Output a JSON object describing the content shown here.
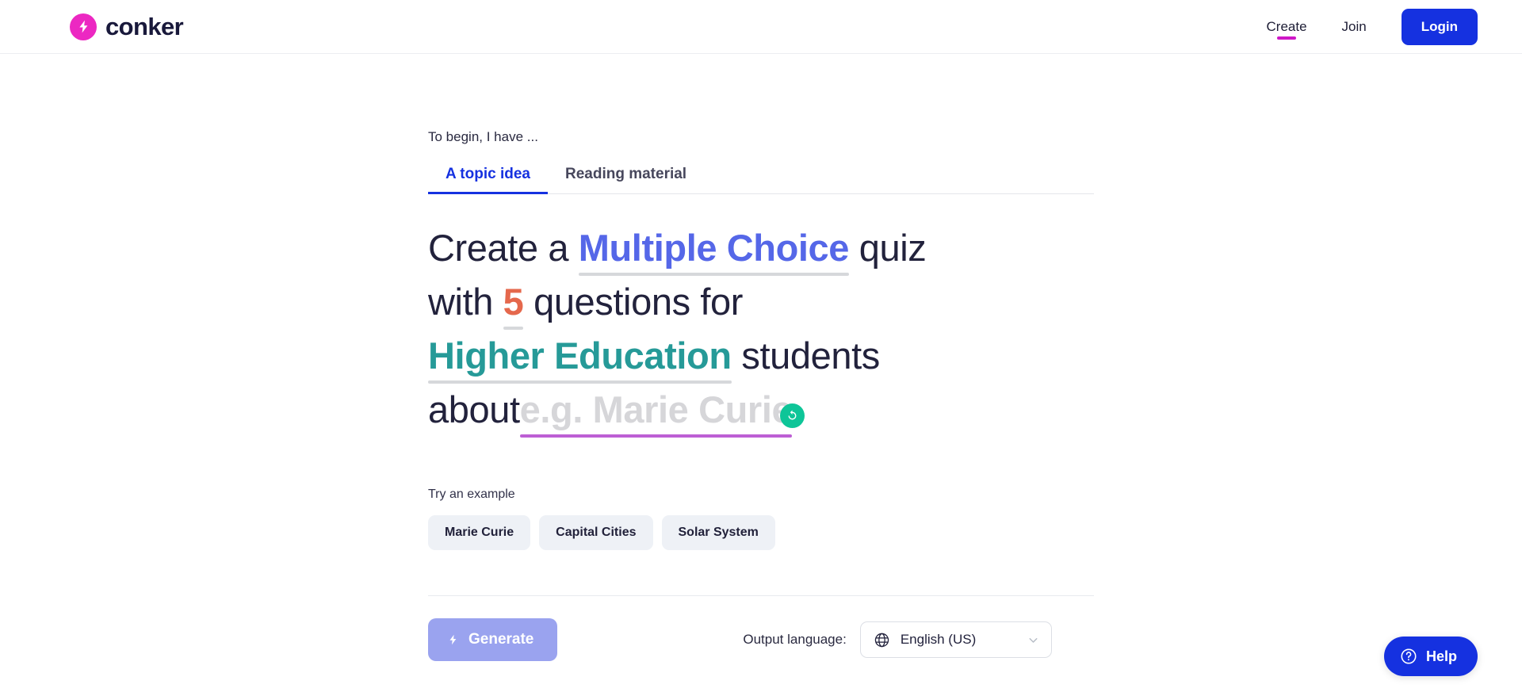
{
  "brand": {
    "name": "conker",
    "logo_icon": "lightning-bolt-icon",
    "logo_color": "#ec28c2"
  },
  "header": {
    "nav": [
      {
        "label": "Create",
        "active": true
      },
      {
        "label": "Join",
        "active": false
      }
    ],
    "login_label": "Login",
    "login_color": "#1531e0",
    "active_underline_color": "#cf17c7"
  },
  "main": {
    "begin_label": "To begin, I have ...",
    "tabs": [
      {
        "label": "A topic idea",
        "active": true
      },
      {
        "label": "Reading material",
        "active": false
      }
    ],
    "active_tab_color": "#1531e0",
    "prompt": {
      "part1": "Create a",
      "quiz_type": "Multiple Choice",
      "quiz_type_color": "#5567e8",
      "part2": "quiz with",
      "question_count": "5",
      "question_count_color": "#e5684c",
      "part3": "questions for",
      "audience": "Higher Education",
      "audience_color": "#269a98",
      "part4": "students about",
      "topic_placeholder": "e.g. Marie Curie",
      "topic_value": "",
      "topic_underline_color": "#bd5fd4",
      "refresh_icon": "refresh-icon",
      "refresh_color": "#0ec598"
    },
    "examples_label": "Try an example",
    "examples": [
      "Marie Curie",
      "Capital Cities",
      "Solar System"
    ],
    "generate_label": "Generate",
    "generate_icon": "lightning-bolt-icon",
    "generate_color": "#9aa3ef",
    "language_label": "Output language:",
    "language_value": "English (US)",
    "language_icon": "globe-icon",
    "language_chevron": "chevron-down-icon"
  },
  "help": {
    "label": "Help",
    "icon": "question-circle-icon",
    "color": "#1531e0"
  }
}
